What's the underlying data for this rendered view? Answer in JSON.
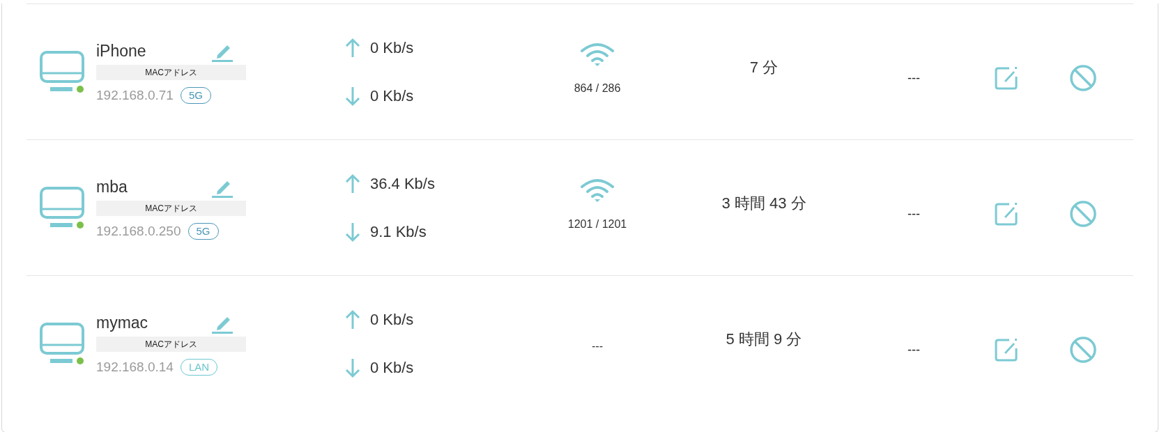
{
  "devices": [
    {
      "name": "iPhone",
      "online": true,
      "mac_label": "MACアドレス",
      "ip": "192.168.0.71",
      "band": {
        "label": "5G",
        "color": "#4a96b8"
      },
      "upload": "0 Kb/s",
      "download": "0 Kb/s",
      "link": {
        "kind": "wifi",
        "text": "864 / 286"
      },
      "duration": "7 分",
      "limit": "---"
    },
    {
      "name": "mba",
      "online": true,
      "mac_label": "MACアドレス",
      "ip": "192.168.0.250",
      "band": {
        "label": "5G",
        "color": "#4a96b8"
      },
      "upload": "36.4 Kb/s",
      "download": "9.1 Kb/s",
      "link": {
        "kind": "wifi",
        "text": "1201 / 1201"
      },
      "duration": "3 時間 43 分",
      "limit": "---"
    },
    {
      "name": "mymac",
      "online": true,
      "mac_label": "MACアドレス",
      "ip": "192.168.0.14",
      "band": {
        "label": "LAN",
        "color": "#6cc6cf"
      },
      "upload": "0 Kb/s",
      "download": "0 Kb/s",
      "link": {
        "kind": "none",
        "text": "---"
      },
      "duration": "5 時間 9 分",
      "limit": "---"
    }
  ]
}
